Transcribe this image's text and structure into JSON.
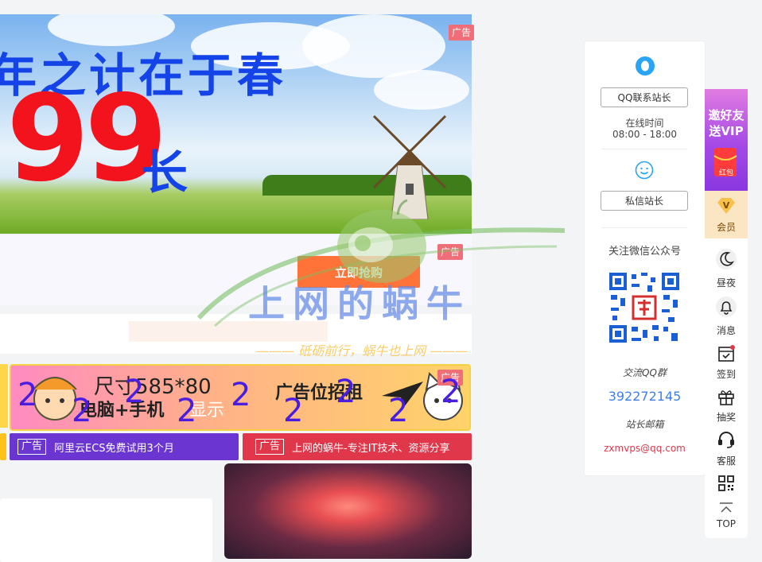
{
  "hero": {
    "title": "年之计在于春",
    "number": "99",
    "suffix": "长",
    "ad_tag": "广告"
  },
  "strip2": {
    "button": "立即抢购",
    "ad_tag": "广告"
  },
  "yellow_ad": {
    "size": "尺寸585*80",
    "devices": "电脑+手机",
    "display": "显示",
    "recruit": "广告位招租",
    "ad_tag": "广告",
    "overlay_digit": "2"
  },
  "text_ads": [
    {
      "tag": "广告",
      "label": "阿里云ECS免费试用3个月",
      "color": "#6a35d0"
    },
    {
      "tag": "广告",
      "label": "上网的蜗牛-专注IT技术、资源分享",
      "color": "#e0374a"
    }
  ],
  "watermark": {
    "title": "上网的蜗牛",
    "subtitle": "——— 砥砺前行，蜗牛也上网 ———"
  },
  "contact": {
    "qq_button": "QQ联系站长",
    "online_label": "在线时间",
    "online_hours": "08:00 - 18:00",
    "message_button": "私信站长",
    "wechat_label": "关注微信公众号",
    "qq_group_label": "交流QQ群",
    "qq_group_number": "392272145",
    "email_label": "站长邮箱",
    "email": "zxmvps@qq.com"
  },
  "toolbar": {
    "invite_line1": "邀好友",
    "invite_line2": "送VIP",
    "red_packet": "红包",
    "vip_badge": "V",
    "vip_label": "会员",
    "items": [
      {
        "label": "昼夜",
        "icon": "moon-icon"
      },
      {
        "label": "消息",
        "icon": "bell-icon"
      },
      {
        "label": "签到",
        "icon": "calendar-icon"
      },
      {
        "label": "抽奖",
        "icon": "gift-icon"
      },
      {
        "label": "客服",
        "icon": "headset-icon"
      },
      {
        "label": "",
        "icon": "qrcode-icon"
      },
      {
        "label": "TOP",
        "icon": "arrow-up-icon"
      }
    ]
  },
  "colors": {
    "accent_orange": "#ff7338",
    "link_blue": "#3f7fe8",
    "email_red": "#e0374a",
    "ad_tag": "#f06e78"
  }
}
